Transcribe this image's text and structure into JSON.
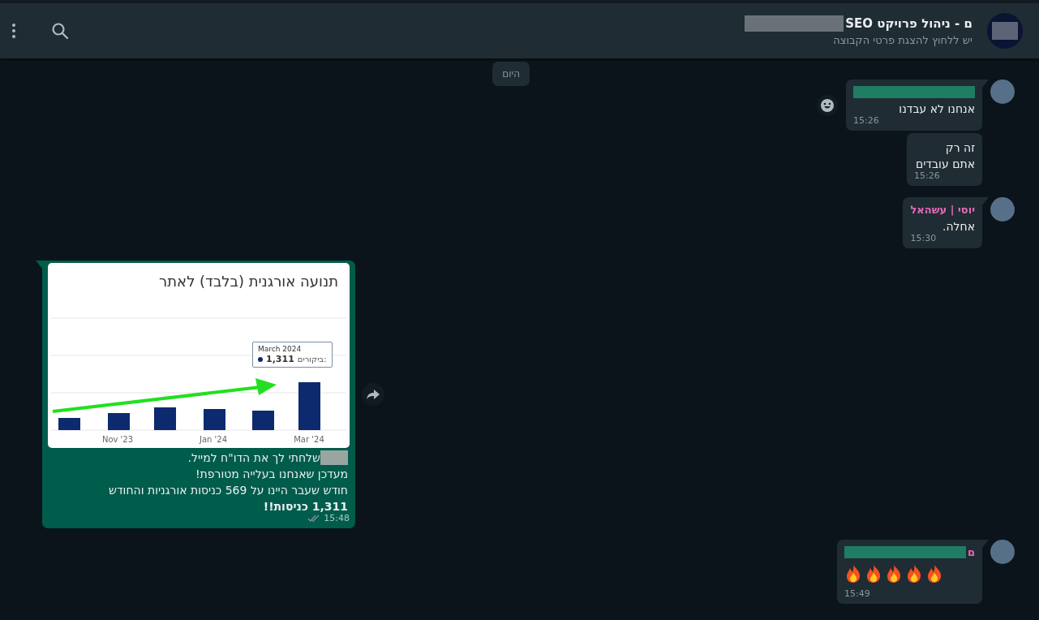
{
  "header": {
    "title": "ם - ניהול פרויקט SEO",
    "subtitle": "יש ללחוץ להצגת פרטי הקבוצה"
  },
  "date_chip": "היום",
  "messages": [
    {
      "kind": "incoming",
      "first_in_group": true,
      "sender_redacted": true,
      "lines": [
        "אנחנו לא עבדנו"
      ],
      "time": "15:26",
      "reaction_button": true
    },
    {
      "kind": "incoming",
      "first_in_group": false,
      "lines": [
        "זה רק",
        "אתם עובדים"
      ],
      "time": "15:26",
      "reaction_button": false
    },
    {
      "kind": "incoming",
      "first_in_group": true,
      "sender": "יוסי | עשהאל",
      "sender_redacted": false,
      "lines": [
        "אחלה."
      ],
      "time": "15:30",
      "reaction_button": false
    },
    {
      "kind": "outgoing",
      "first_in_group": true,
      "image": {
        "title": "תנועה אורגנית (בלבד) לאתר",
        "tooltip_title": "March 2024",
        "tooltip_label": "ביקורים:",
        "tooltip_value": "1,311",
        "x_labels": [
          "Mar '24",
          "Jan '24",
          "Nov '23"
        ]
      },
      "lines": [
        "שלחתי לך את הדו\"ח למייל.",
        "מעדכן שאנחנו בעלייה מטורפת!",
        "חודש שעבר היינו על 569 כניסות אורגניות והחודש",
        "**1,311 כניסות!!**"
      ],
      "first_line_redacted": true,
      "time": "15:48",
      "read": false,
      "forward_button": true
    },
    {
      "kind": "incoming",
      "first_in_group": true,
      "sender": "ם",
      "sender_redacted": true,
      "emojis": [
        {
          "kind": "fire"
        },
        {
          "kind": "fire"
        },
        {
          "kind": "fire"
        },
        {
          "kind": "fire"
        },
        {
          "kind": "fire"
        }
      ],
      "time": "15:49",
      "reaction_button": false
    }
  ]
}
